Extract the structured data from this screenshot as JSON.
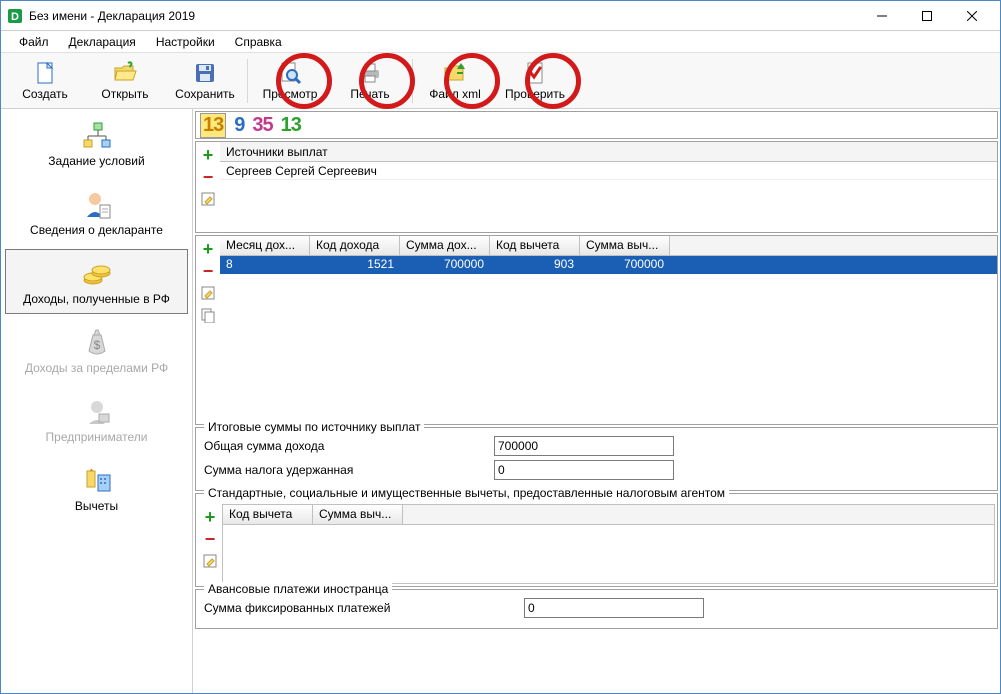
{
  "window": {
    "title": "Без имени - Декларация 2019"
  },
  "menu": {
    "file": "Файл",
    "declaration": "Декларация",
    "settings": "Настройки",
    "help": "Справка"
  },
  "toolbar": {
    "create": "Создать",
    "open": "Открыть",
    "save": "Сохранить",
    "preview": "Просмотр",
    "print": "Печать",
    "xml": "Файл xml",
    "check": "Проверить"
  },
  "sidebar": {
    "conditions": "Задание условий",
    "declarant": "Сведения о декларанте",
    "income_rf": "Доходы, полученные в РФ",
    "income_foreign": "Доходы за пределами РФ",
    "entrepreneurs": "Предприниматели",
    "deductions": "Вычеты"
  },
  "tabs": {
    "t1": "13",
    "t2": "9",
    "t3": "35",
    "t4": "13"
  },
  "sources": {
    "header": "Источники выплат",
    "row0": "Сергеев Сергей Сергеевич"
  },
  "income_grid": {
    "h_month": "Месяц дох...",
    "h_code": "Код дохода",
    "h_sum_inc": "Сумма дох...",
    "h_ded_code": "Код вычета",
    "h_sum_ded": "Сумма выч...",
    "r0_month": "8",
    "r0_code": "1521",
    "r0_sum_inc": "700000",
    "r0_ded_code": "903",
    "r0_sum_ded": "700000"
  },
  "totals": {
    "legend": "Итоговые суммы по источнику выплат",
    "total_income_label": "Общая сумма дохода",
    "total_income_value": "700000",
    "tax_withheld_label": "Сумма налога удержанная",
    "tax_withheld_value": "0"
  },
  "agent_deductions": {
    "legend": "Стандартные, социальные и имущественные вычеты, предоставленные налоговым агентом",
    "h_code": "Код вычета",
    "h_sum": "Сумма выч..."
  },
  "advance": {
    "legend": "Авансовые платежи иностранца",
    "fixed_label": "Сумма фиксированных платежей",
    "fixed_value": "0"
  }
}
